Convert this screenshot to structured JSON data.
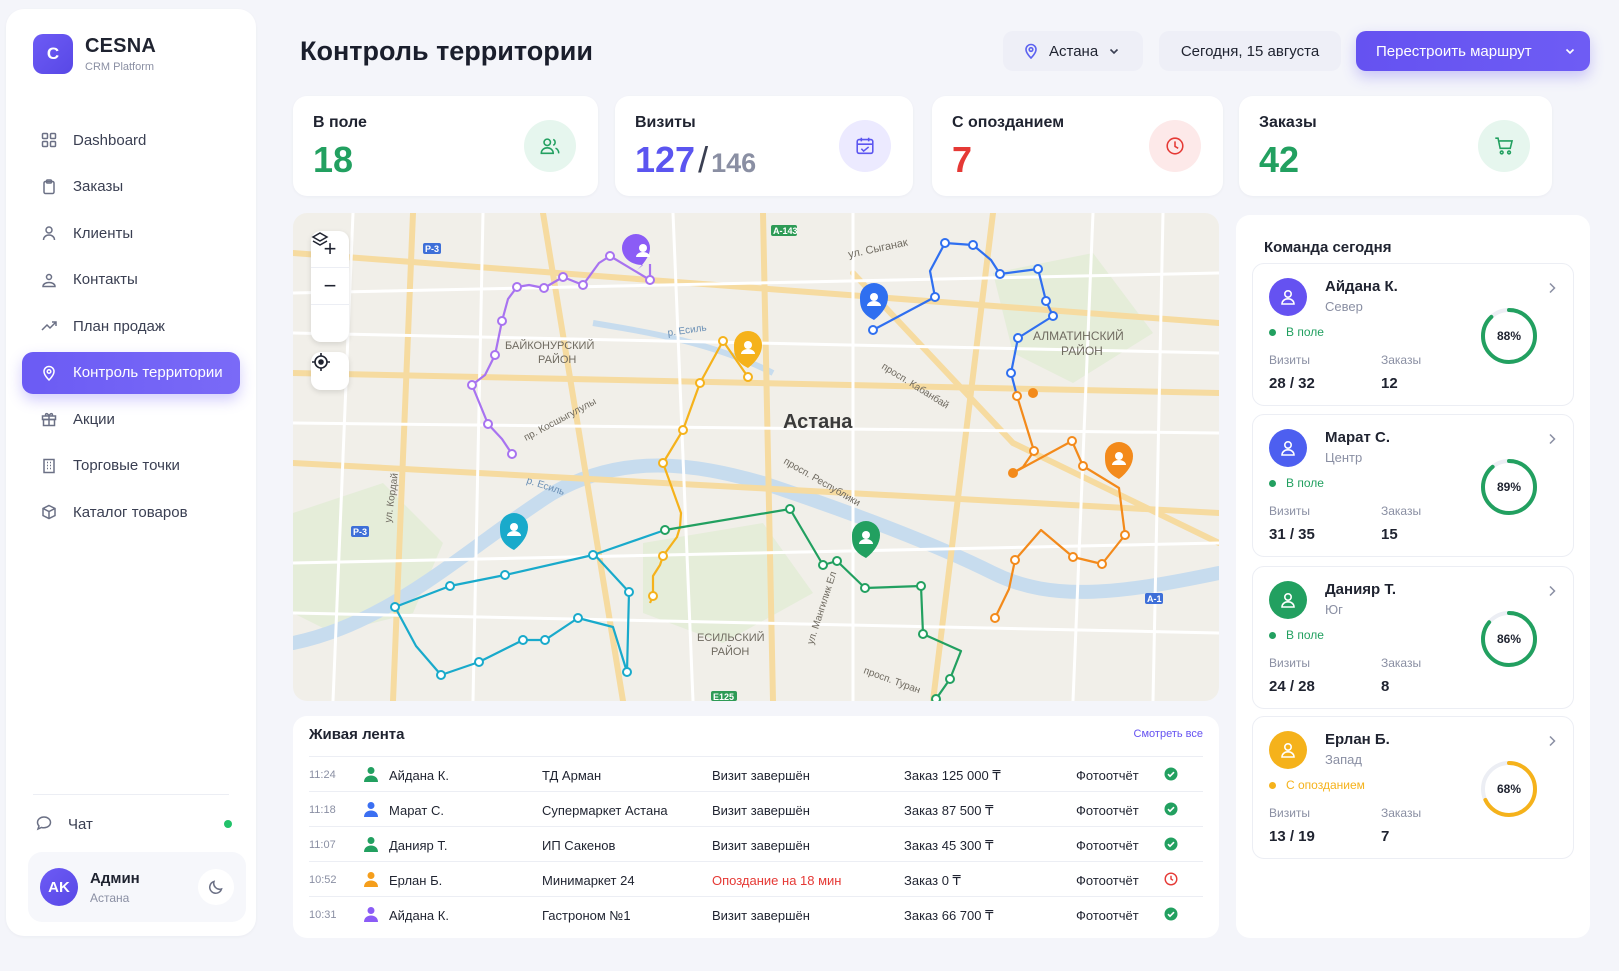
{
  "brand": {
    "logo_letter": "C",
    "name": "CESNA",
    "subtitle": "CRM Platform"
  },
  "sidebar": {
    "items": [
      {
        "label": "Dashboard",
        "icon": "dashboard-icon"
      },
      {
        "label": "Заказы",
        "icon": "clipboard-icon"
      },
      {
        "label": "Клиенты",
        "icon": "user-icon"
      },
      {
        "label": "Контакты",
        "icon": "contacts-icon"
      },
      {
        "label": "План продаж",
        "icon": "trend-icon"
      },
      {
        "label": "Контроль территории",
        "icon": "location-pin-icon",
        "active": true
      },
      {
        "label": "Акции",
        "icon": "gift-icon"
      },
      {
        "label": "Торговые точки",
        "icon": "building-icon"
      },
      {
        "label": "Каталог товаров",
        "icon": "box-icon"
      }
    ],
    "chat_label": "Чат",
    "user": {
      "initials": "AK",
      "name": "Админ",
      "city": "Астана"
    }
  },
  "header": {
    "title": "Контроль территории",
    "city": "Астана",
    "date": "Сегодня, 15 августа",
    "route_button": "Перестроить маршрут"
  },
  "kpis": {
    "in_field": {
      "label": "В поле",
      "value": "18",
      "color": "#22a060"
    },
    "visits": {
      "label": "Визиты",
      "value": "127",
      "slash": "/",
      "total": "146",
      "color": "#5b55f0"
    },
    "late": {
      "label": "С опозданием",
      "value": "7",
      "color": "#e53935"
    },
    "orders": {
      "label": "Заказы",
      "value": "42",
      "color": "#22a060"
    }
  },
  "map": {
    "city_label": "Астана",
    "district_labels": [
      "БАЙКОНУРСКИЙ",
      "РАЙОН",
      "АЛМАТИНСКИЙ",
      "РАЙОН",
      "ЕСИЛЬСКИЙ",
      "РАЙОН"
    ],
    "street_labels": [
      "ул. Сыганак",
      "р. Есиль",
      "просп. Кабанбай",
      "просп. Республики",
      "пр. Косшыгулулы",
      "р. Есиль",
      "ул. Кордай",
      "просп. Туран",
      "ул. Мангилик Ел"
    ],
    "road_badges": [
      "Р-3",
      "А-143",
      "Р-3",
      "А-1",
      "Е125"
    ],
    "controls": {
      "zoom_in": "+",
      "zoom_out": "−"
    }
  },
  "feed": {
    "title": "Живая лента",
    "view_all": "Смотреть все",
    "rows": [
      {
        "time": "11:24",
        "name": "Айдана К.",
        "shop": "ТД Арман",
        "status": "Визит завершён",
        "order": "Заказ 125 000 ₸",
        "photo": "Фотоотчёт",
        "color": "#22a060",
        "late": false
      },
      {
        "time": "11:18",
        "name": "Марат С.",
        "shop": "Супермаркет Астана",
        "status": "Визит завершён",
        "order": "Заказ 87 500 ₸",
        "photo": "Фотоотчёт",
        "color": "#3b6ff2",
        "late": false
      },
      {
        "time": "11:07",
        "name": "Данияр Т.",
        "shop": "ИП Сакенов",
        "status": "Визит завершён",
        "order": "Заказ 45 300 ₸",
        "photo": "Фотоотчёт",
        "color": "#22a060",
        "late": false
      },
      {
        "time": "10:52",
        "name": "Ерлан Б.",
        "shop": "Минимаркет 24",
        "status": "Опоздание на 18 мин",
        "order": "Заказ 0 ₸",
        "photo": "Фотоотчёт",
        "color": "#f59e1b",
        "late": true
      },
      {
        "time": "10:31",
        "name": "Айдана К.",
        "shop": "Гастроном №1",
        "status": "Визит завершён",
        "order": "Заказ 66 700 ₸",
        "photo": "Фотоотчёт",
        "color": "#8b5cf6",
        "late": false
      }
    ]
  },
  "team": {
    "title": "Команда сегодня",
    "members": [
      {
        "name": "Айдана К.",
        "region": "Север",
        "status": "В поле",
        "status_color": "#22a060",
        "visits_label": "Визиты",
        "visits": "28 / 32",
        "orders_label": "Заказы",
        "orders": "12",
        "progress": 88,
        "pct": "88%",
        "avatar_color": "#6552f1",
        "ring_color": "#22a060"
      },
      {
        "name": "Марат С.",
        "region": "Центр",
        "status": "В поле",
        "status_color": "#22a060",
        "visits_label": "Визиты",
        "visits": "31 / 35",
        "orders_label": "Заказы",
        "orders": "15",
        "progress": 89,
        "pct": "89%",
        "avatar_color": "#4d5ff0",
        "ring_color": "#22a060"
      },
      {
        "name": "Данияр Т.",
        "region": "Юг",
        "status": "В поле",
        "status_color": "#22a060",
        "visits_label": "Визиты",
        "visits": "24 / 28",
        "orders_label": "Заказы",
        "orders": "8",
        "progress": 86,
        "pct": "86%",
        "avatar_color": "#22a060",
        "ring_color": "#22a060"
      },
      {
        "name": "Ерлан Б.",
        "region": "Запад",
        "status": "С опозданием",
        "status_color": "#f5b21b",
        "visits_label": "Визиты",
        "visits": "13 / 19",
        "orders_label": "Заказы",
        "orders": "7",
        "progress": 68,
        "pct": "68%",
        "avatar_color": "#f5b21b",
        "ring_color": "#f5b21b"
      }
    ]
  }
}
